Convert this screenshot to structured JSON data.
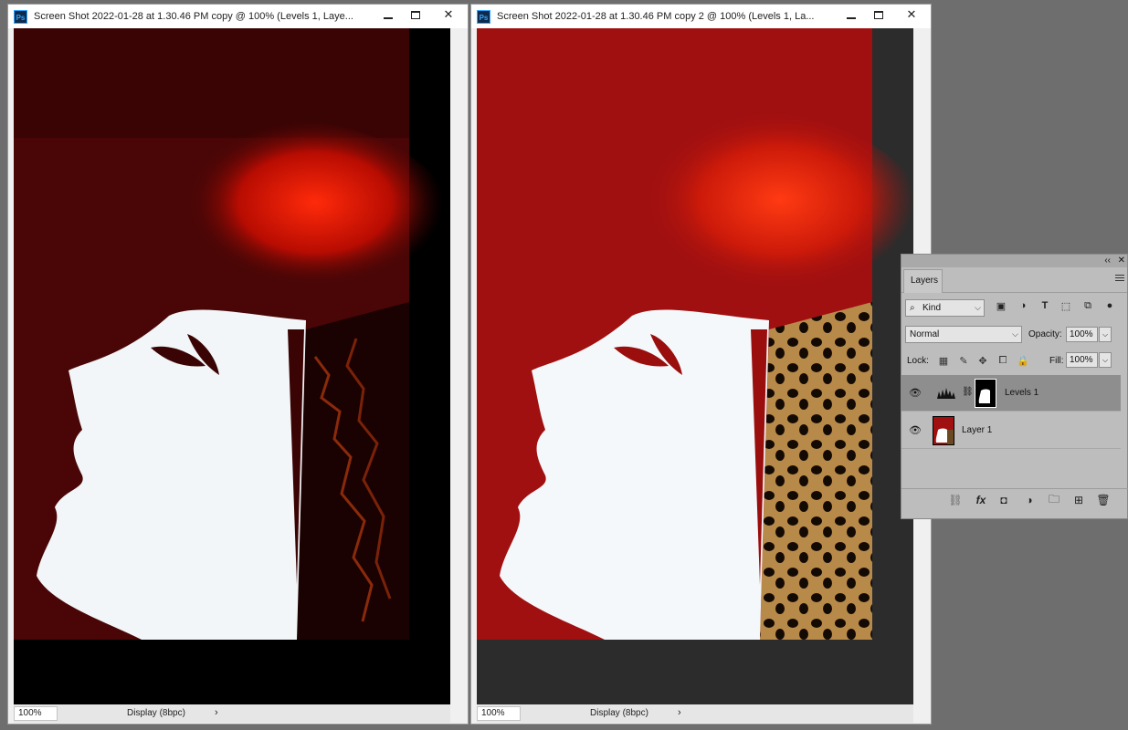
{
  "windows": [
    {
      "app_icon": "Ps",
      "title": "Screen Shot 2022-01-28 at 1.30.46 PM copy @ 100% (Levels 1, Laye...",
      "zoom": "100%",
      "status": "Display (8bpc)",
      "status_arrow": "›"
    },
    {
      "app_icon": "Ps",
      "title": "Screen Shot 2022-01-28 at 1.30.46 PM copy 2 @ 100% (Levels 1, La...",
      "zoom": "100%",
      "status": "Display (8bpc)",
      "status_arrow": "›"
    }
  ],
  "window_controls": {
    "close": "✕"
  },
  "layers_panel": {
    "tab": "Layers",
    "collapse": "‹‹",
    "close": "✕",
    "filter": {
      "value": "Kind",
      "search_icon": "⌕"
    },
    "blend_mode": "Normal",
    "opacity_label": "Opacity:",
    "opacity": "100%",
    "lock_label": "Lock:",
    "fill_label": "Fill:",
    "fill": "100%",
    "layers": [
      {
        "name": "Levels 1",
        "selected": true,
        "visible_icon": "👁"
      },
      {
        "name": "Layer 1",
        "selected": false,
        "visible_icon": "👁"
      }
    ],
    "footer_icons": {
      "link": "⛓",
      "fx": "fx",
      "mask": "◘",
      "adjustment": "◑",
      "folder": "🗀",
      "new": "⊞",
      "trash": "🗑"
    }
  },
  "colors": {
    "panel_bg": "#bdbdbd",
    "selected_layer": "#8e8e8e",
    "red_bg": "#a11010",
    "dark_red_bg": "#4a0606"
  }
}
